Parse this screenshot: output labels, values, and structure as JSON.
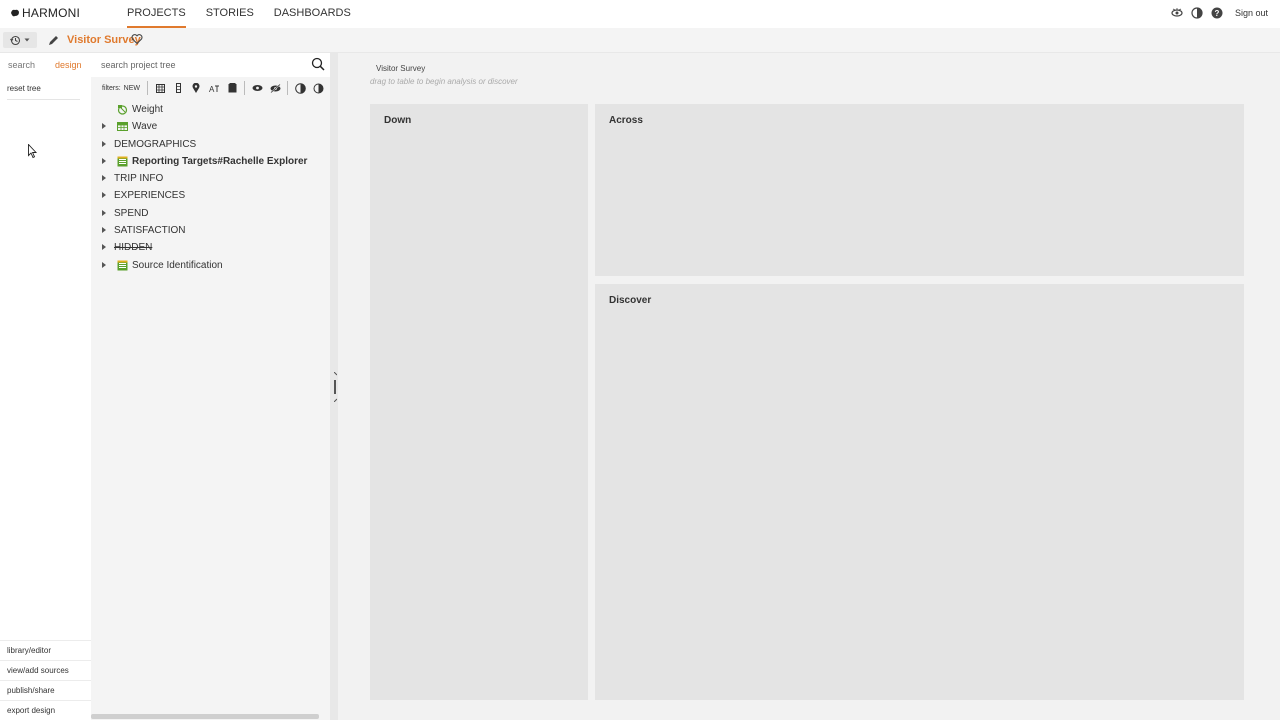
{
  "app": {
    "logo_text": "HARMONI"
  },
  "nav": {
    "items": [
      {
        "label": "PROJECTS",
        "active": true
      },
      {
        "label": "STORIES",
        "active": false
      },
      {
        "label": "DASHBOARDS",
        "active": false
      }
    ]
  },
  "top_right": {
    "sign_out": "Sign out",
    "icons": [
      "eye-icon",
      "contrast-icon",
      "help-icon"
    ]
  },
  "project": {
    "title": "Visitor Survey",
    "icons": [
      "history-icon",
      "chevron-down-icon",
      "pencil-icon",
      "heart-icon"
    ]
  },
  "left_col": {
    "tabs": [
      {
        "label": "search",
        "active": false
      },
      {
        "label": "design",
        "active": true
      }
    ],
    "reset_label": "reset tree",
    "bottom_links": [
      "library/editor",
      "view/add sources",
      "publish/share",
      "export design"
    ]
  },
  "tree_panel": {
    "search_placeholder": "search project tree",
    "filters_label": "filters:",
    "filters_new": "NEW",
    "filter_icons": [
      "grid-icon",
      "column-icon",
      "location-pin-icon",
      "text-size-icon",
      "stack-icon",
      "eye-icon",
      "eye-slash-icon",
      "half-circle-icon",
      "filled-circle-icon"
    ],
    "items": [
      {
        "label": "Weight",
        "type": "variable",
        "icon": "weight-icon",
        "expandable": false,
        "bold": false,
        "strike": false
      },
      {
        "label": "Wave",
        "type": "variable",
        "icon": "grid-variable-icon",
        "expandable": true,
        "bold": false,
        "strike": false
      },
      {
        "label": "DEMOGRAPHICS",
        "type": "folder",
        "expandable": true,
        "bold": false,
        "strike": false
      },
      {
        "label": "Reporting Targets#Rachelle Explorer",
        "type": "variable",
        "icon": "table-variable-icon",
        "expandable": true,
        "bold": true,
        "strike": false
      },
      {
        "label": "TRIP INFO",
        "type": "folder",
        "expandable": true,
        "bold": false,
        "strike": false
      },
      {
        "label": "EXPERIENCES",
        "type": "folder",
        "expandable": true,
        "bold": false,
        "strike": false
      },
      {
        "label": "SPEND",
        "type": "folder",
        "expandable": true,
        "bold": false,
        "strike": false
      },
      {
        "label": "SATISFACTION",
        "type": "folder",
        "expandable": true,
        "bold": false,
        "strike": false
      },
      {
        "label": "HIDDEN",
        "type": "folder",
        "expandable": true,
        "bold": false,
        "strike": true
      },
      {
        "label": "Source Identification",
        "type": "variable",
        "icon": "table-variable-icon",
        "expandable": true,
        "bold": false,
        "strike": false
      }
    ]
  },
  "main": {
    "title": "Visitor Survey",
    "hint": "drag to table to begin analysis or discover",
    "zones": {
      "down": "Down",
      "across": "Across",
      "discover": "Discover"
    }
  },
  "colors": {
    "accent": "#e07a2e",
    "panel_bg": "#f4f4f4",
    "zone_bg": "#e4e4e4",
    "variable_green": "#5aa02c"
  }
}
